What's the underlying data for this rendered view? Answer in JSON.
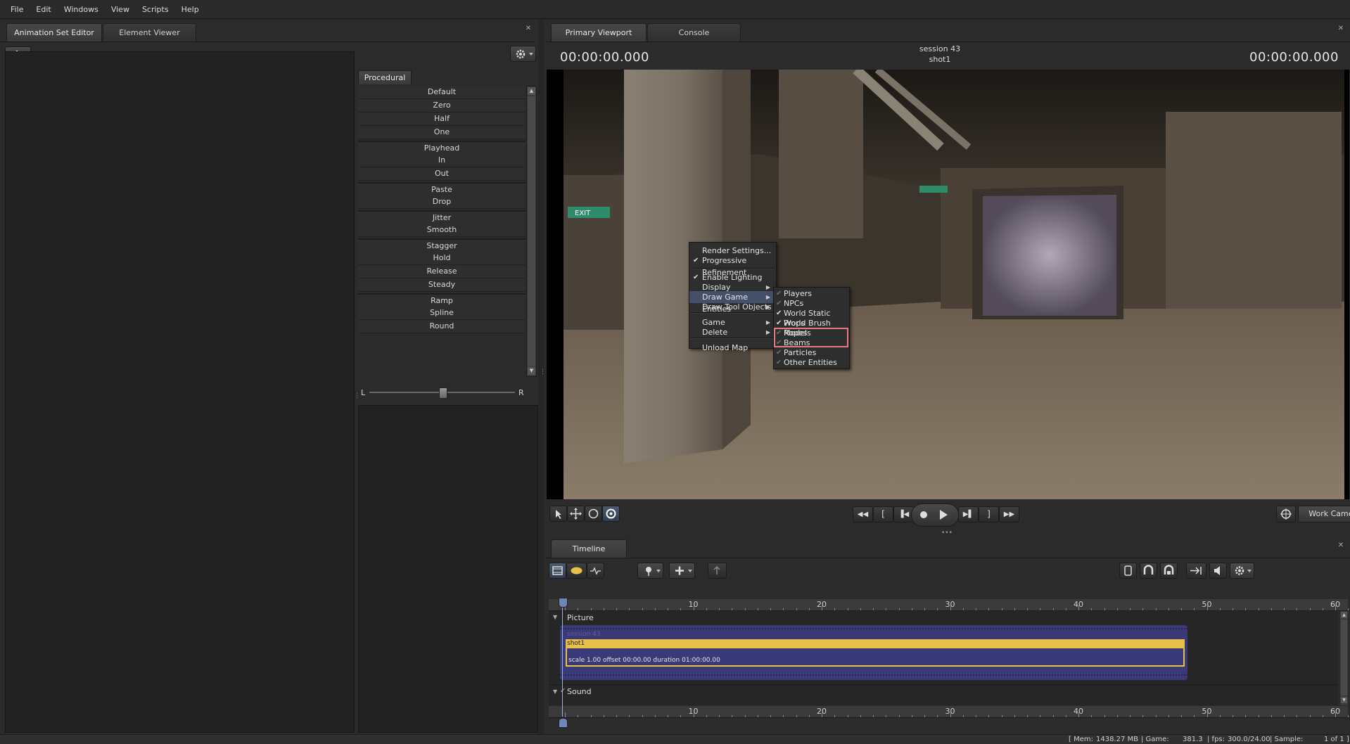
{
  "menu": [
    "File",
    "Edit",
    "Windows",
    "View",
    "Scripts",
    "Help"
  ],
  "left": {
    "tabs": [
      "Animation Set Editor",
      "Element Viewer"
    ],
    "procedural_tab": "Procedural",
    "procedural_items": [
      {
        "label": "Default",
        "sep": false
      },
      {
        "label": "Zero",
        "sep": false
      },
      {
        "label": "Half",
        "sep": false
      },
      {
        "label": "One",
        "sep": false
      },
      {
        "label": "Playhead",
        "sep": true
      },
      {
        "label": "In",
        "sep": false
      },
      {
        "label": "Out",
        "sep": false
      },
      {
        "label": "Paste",
        "sep": true
      },
      {
        "label": "Drop",
        "sep": false
      },
      {
        "label": "Jitter",
        "sep": true
      },
      {
        "label": "Smooth",
        "sep": false
      },
      {
        "label": "Stagger",
        "sep": true
      },
      {
        "label": "Hold",
        "sep": false
      },
      {
        "label": "Release",
        "sep": false
      },
      {
        "label": "Steady",
        "sep": false
      },
      {
        "label": "Ramp",
        "sep": true
      },
      {
        "label": "Spline",
        "sep": false
      },
      {
        "label": "Round",
        "sep": false
      }
    ],
    "slider_left": "L",
    "slider_right": "R",
    "slider_value": 0.5
  },
  "viewport": {
    "tabs": [
      "Primary Viewport",
      "Console"
    ],
    "session": "session 43",
    "shot": "shot1",
    "timecode_left": "00:00:00.000",
    "timecode_right": "00:00:00.000",
    "camera": "Work Camera"
  },
  "context_menu": {
    "items": [
      {
        "label": "Render Settings...",
        "check": false,
        "arrow": false
      },
      {
        "label": "Progressive Refinement",
        "check": true,
        "arrow": false
      },
      {
        "label": "Enable Lighting",
        "check": true,
        "arrow": false
      },
      {
        "label": "Display",
        "check": false,
        "arrow": true
      },
      {
        "label": "Draw Game Entities",
        "check": false,
        "arrow": true
      },
      {
        "label": "Draw Tool Objects",
        "check": false,
        "arrow": true
      },
      {
        "label": "Game",
        "check": false,
        "arrow": true
      },
      {
        "label": "Delete",
        "check": false,
        "arrow": true
      },
      {
        "label": "Unload Map",
        "check": false,
        "arrow": false
      }
    ],
    "submenu": [
      {
        "label": "Players",
        "check": "dim"
      },
      {
        "label": "NPCs",
        "check": "dim"
      },
      {
        "label": "World Static Props",
        "check": "on"
      },
      {
        "label": "World Brush Models",
        "check": "on"
      },
      {
        "label": "Ropes",
        "check": "dim"
      },
      {
        "label": "Beams",
        "check": "dim"
      },
      {
        "label": "Particles",
        "check": "dim"
      },
      {
        "label": "Other Entities",
        "check": "dim"
      }
    ]
  },
  "timeline": {
    "tab": "Timeline",
    "ticks": [
      "10",
      "20",
      "30",
      "40",
      "50",
      "60"
    ],
    "picture_label": "Picture",
    "sound_label": "Sound",
    "session_clip": "session 43",
    "shot_clip": "shot1",
    "clip_info": "scale 1.00 offset  00:00.00 duration  01:00:00.00"
  },
  "status": {
    "mem_label": "[ Mem:",
    "mem_value": "1438.27 MB",
    "game_label": "| Game:",
    "game_value": "381.3",
    "fps_label": "| fps:",
    "fps_value": "300.0/24.00",
    "sample_label": "| Sample:",
    "page": "1 of 1 ]"
  },
  "colors": {
    "highlight_box": "#e87a7a",
    "clip_blue": "#3a3a78",
    "clip_yellow": "#e8c048",
    "menu_highlight": "#44506a"
  }
}
